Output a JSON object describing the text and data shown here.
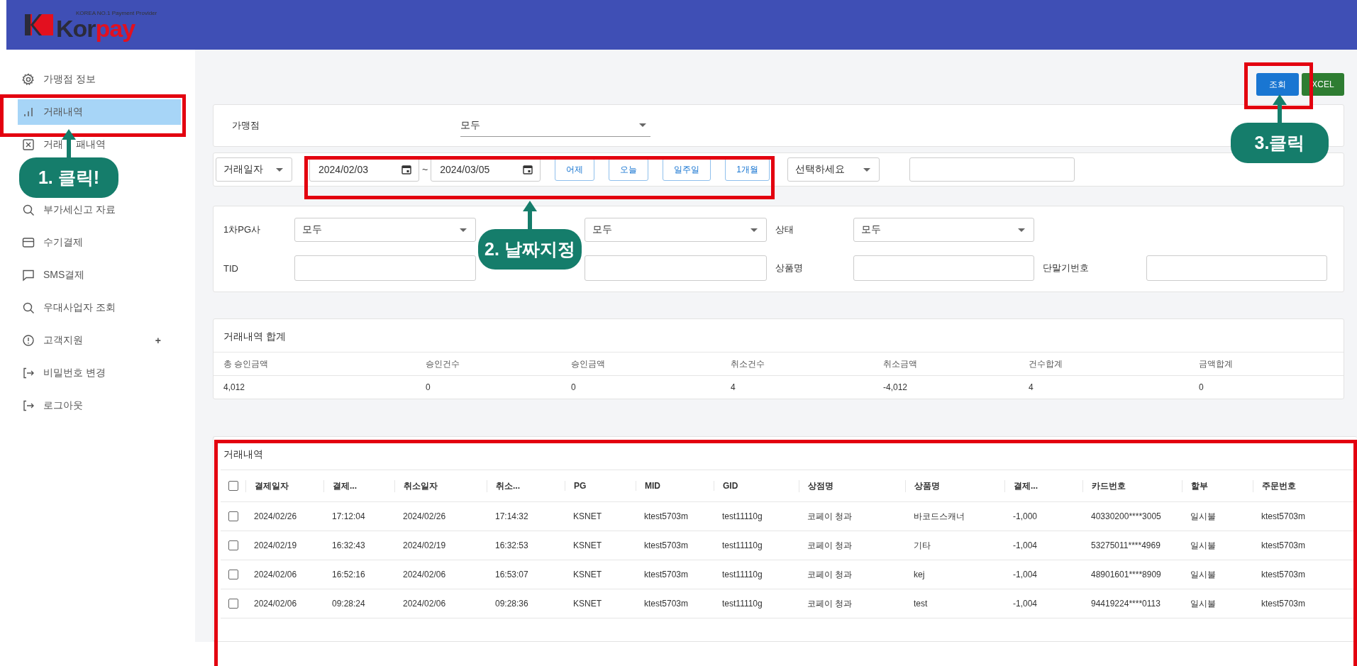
{
  "header": {
    "logo": {
      "text": "Kor",
      "accent": "pay",
      "tagline": "KOREA NO.1 Payment Provider"
    }
  },
  "sidebar": {
    "items": [
      {
        "label": "가맹점 정보",
        "selected": false
      },
      {
        "label": "거래내역",
        "selected": true
      },
      {
        "label": "거래 패내역",
        "selected": false
      },
      {
        "label": "부가세신고 자료",
        "selected": false
      },
      {
        "label": "수기결제",
        "selected": false
      },
      {
        "label": "SMS결제",
        "selected": false
      },
      {
        "label": "우대사업자 조회",
        "selected": false
      },
      {
        "label": "고객지원",
        "selected": false,
        "suffix": "+"
      },
      {
        "label": "비밀번호 변경",
        "selected": false
      },
      {
        "label": "로그아웃",
        "selected": false
      }
    ]
  },
  "actions": [
    {
      "label": "조회",
      "kind": "primary"
    },
    {
      "label": "XCEL",
      "kind": "success"
    }
  ],
  "merchant_filter": {
    "label": "가맹점",
    "value": "모두"
  },
  "date_filter": {
    "type_select": "거래일자",
    "from": "2024/02/03",
    "separator": "~",
    "to": "2024/03/05",
    "presets": [
      "어제",
      "오늘",
      "일주일",
      "1개월"
    ],
    "option_select": "선택하세요"
  },
  "detail_filters": [
    [
      {
        "label": "1차PG사",
        "kind": "select",
        "value": "모두"
      },
      {
        "kind": "select",
        "value": "모두"
      },
      {
        "label": "상태",
        "kind": "select",
        "value": "모두"
      }
    ],
    [
      {
        "label": "TID",
        "kind": "input"
      },
      {
        "kind": "input"
      },
      {
        "label": "상품명",
        "kind": "input"
      },
      {
        "label": "단말기번호",
        "kind": "input"
      }
    ]
  ],
  "summary": {
    "title": "거래내역 합계",
    "columns": [
      "총 승인금액",
      "승인건수",
      "승인금액",
      "취소건수",
      "취소금액",
      "건수합계",
      "금액합계"
    ],
    "values": [
      "4,012",
      "0",
      "0",
      "4",
      "-4,012",
      "4",
      "0"
    ]
  },
  "transactions": {
    "title": "거래내역",
    "header_checked": false,
    "columns": [
      "결제일자",
      "결제...",
      "취소일자",
      "취소...",
      "PG",
      "MID",
      "GID",
      "상점명",
      "상품명",
      "결제...",
      "카드번호",
      "할부",
      "주문번호"
    ],
    "rows": [
      {
        "checked": false,
        "cells": [
          "2024/02/26",
          "17:12:04",
          "2024/02/26",
          "17:14:32",
          "KSNET",
          "ktest5703m",
          "test11110g",
          "코페이 청과",
          "바코드스캐너",
          "-1,000",
          "40330200****3005",
          "일시불",
          "ktest5703m"
        ]
      },
      {
        "checked": false,
        "cells": [
          "2024/02/19",
          "16:32:43",
          "2024/02/19",
          "16:32:53",
          "KSNET",
          "ktest5703m",
          "test11110g",
          "코페이 청과",
          "기타",
          "-1,004",
          "53275011****4969",
          "일시불",
          "ktest5703m"
        ]
      },
      {
        "checked": false,
        "cells": [
          "2024/02/06",
          "16:52:16",
          "2024/02/06",
          "16:53:07",
          "KSNET",
          "ktest5703m",
          "test11110g",
          "코페이 청과",
          "kej",
          "-1,004",
          "48901601****8909",
          "일시불",
          "ktest5703m"
        ]
      },
      {
        "checked": false,
        "cells": [
          "2024/02/06",
          "09:28:24",
          "2024/02/06",
          "09:28:36",
          "KSNET",
          "ktest5703m",
          "test11110g",
          "코페이 청과",
          "test",
          "-1,004",
          "94419224****0113",
          "일시불",
          "ktest5703m"
        ]
      }
    ]
  },
  "annotations": [
    "1. 클릭!",
    "2. 날짜지정",
    "3.클릭"
  ]
}
